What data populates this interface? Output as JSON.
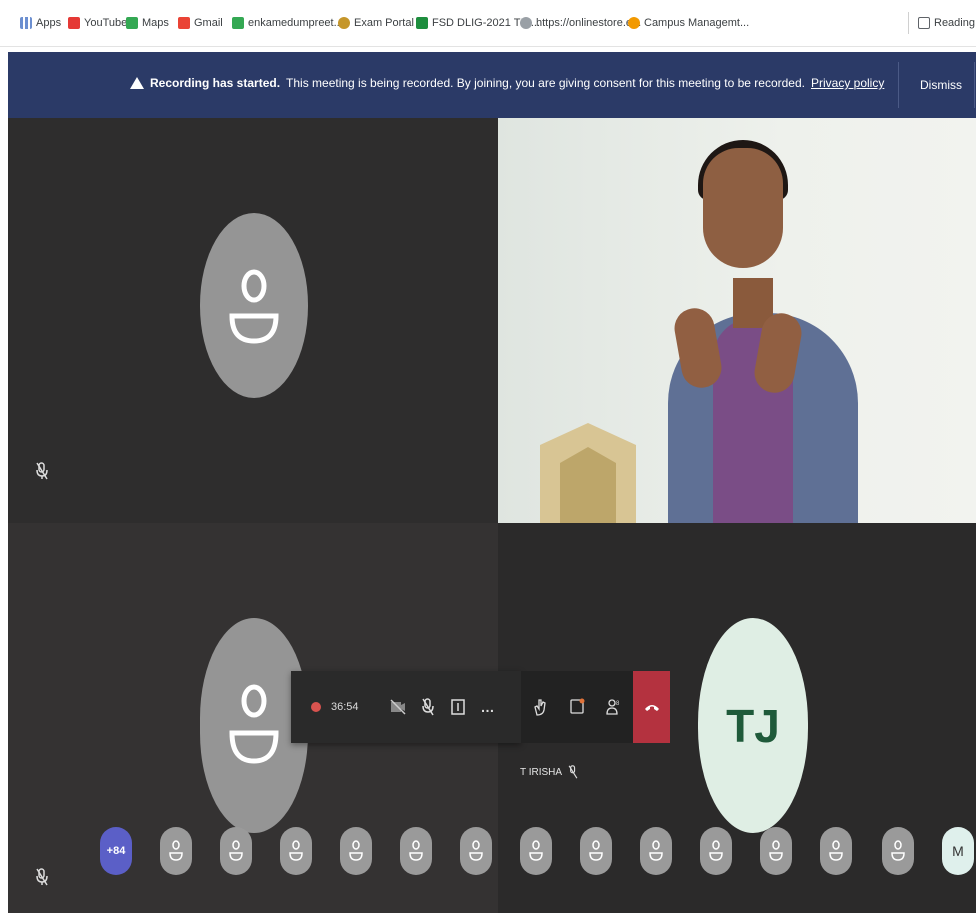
{
  "bookmarks": [
    {
      "label": "Apps",
      "color": "#6c8fd0"
    },
    {
      "label": "YouTube",
      "color": "#e53935"
    },
    {
      "label": "Maps",
      "color": "#34a853"
    },
    {
      "label": "Gmail",
      "color": "#ea4335"
    },
    {
      "label": "enkamedumpreet...",
      "color": "#34a853"
    },
    {
      "label": "Exam Portal",
      "color": "#c5962a"
    },
    {
      "label": "FSD DLIG-2021 TIA...",
      "color": "#1e8e3e"
    },
    {
      "label": "https://onlinestore.e...",
      "color": "#9aa0a6"
    },
    {
      "label": "Campus Managemt...",
      "color": "#f29900"
    }
  ],
  "reading_list": "Reading list",
  "banner": {
    "title": "Recording has started.",
    "message": "This meeting is being recorded. By joining, you are giving consent for this meeting to be recorded.",
    "link": "Privacy policy",
    "dismiss": "Dismiss"
  },
  "toolbar": {
    "timer": "36:54"
  },
  "participant_name": "T IRISHA",
  "tile_br_initials": "TJ",
  "strip": {
    "more": "+84",
    "last_initial": "M"
  },
  "colors": {
    "banner": "#2b3a67",
    "hangup": "#b4323f",
    "tj_avatar": "#dfeee4",
    "tj_text": "#1f5a3a"
  }
}
